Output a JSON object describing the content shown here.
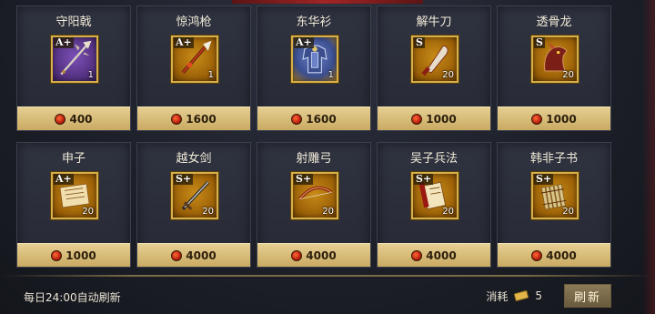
{
  "shop": {
    "items": [
      {
        "name": "守阳戟",
        "grade": "A+",
        "qty": "1",
        "price": "400",
        "icon": "halberd-icon",
        "frame": "purple"
      },
      {
        "name": "惊鸿枪",
        "grade": "A+",
        "qty": "1",
        "price": "1600",
        "icon": "spear-icon",
        "frame": "gold"
      },
      {
        "name": "东华衫",
        "grade": "A+",
        "qty": "1",
        "price": "1600",
        "icon": "armor-icon",
        "frame": "blue"
      },
      {
        "name": "解牛刀",
        "grade": "S",
        "qty": "20",
        "price": "1000",
        "icon": "cleaver-icon",
        "frame": "gold"
      },
      {
        "name": "透骨龙",
        "grade": "S",
        "qty": "20",
        "price": "1000",
        "icon": "dragon-mount-icon",
        "frame": "gold"
      },
      {
        "name": "申子",
        "grade": "A+",
        "qty": "20",
        "price": "1000",
        "icon": "scroll-icon",
        "frame": "gold"
      },
      {
        "name": "越女剑",
        "grade": "S+",
        "qty": "20",
        "price": "4000",
        "icon": "sword-icon",
        "frame": "gold"
      },
      {
        "name": "射雕弓",
        "grade": "S+",
        "qty": "20",
        "price": "4000",
        "icon": "bow-icon",
        "frame": "gold"
      },
      {
        "name": "吴子兵法",
        "grade": "S+",
        "qty": "20",
        "price": "4000",
        "icon": "war-manual-icon",
        "frame": "gold"
      },
      {
        "name": "韩非子书",
        "grade": "S+",
        "qty": "20",
        "price": "4000",
        "icon": "bamboo-book-icon",
        "frame": "gold"
      }
    ]
  },
  "footer": {
    "refresh_note": "每日24:00自动刷新",
    "cost_label": "消耗",
    "cost_value": "5",
    "refresh_button": "刷新"
  },
  "colors": {
    "card_bg": "#2b2e3a",
    "price_bar": "#d9bf7c",
    "item_frame_gold": "#b87612",
    "item_frame_purple": "#5d3a8f",
    "coin": "#c9301a"
  }
}
